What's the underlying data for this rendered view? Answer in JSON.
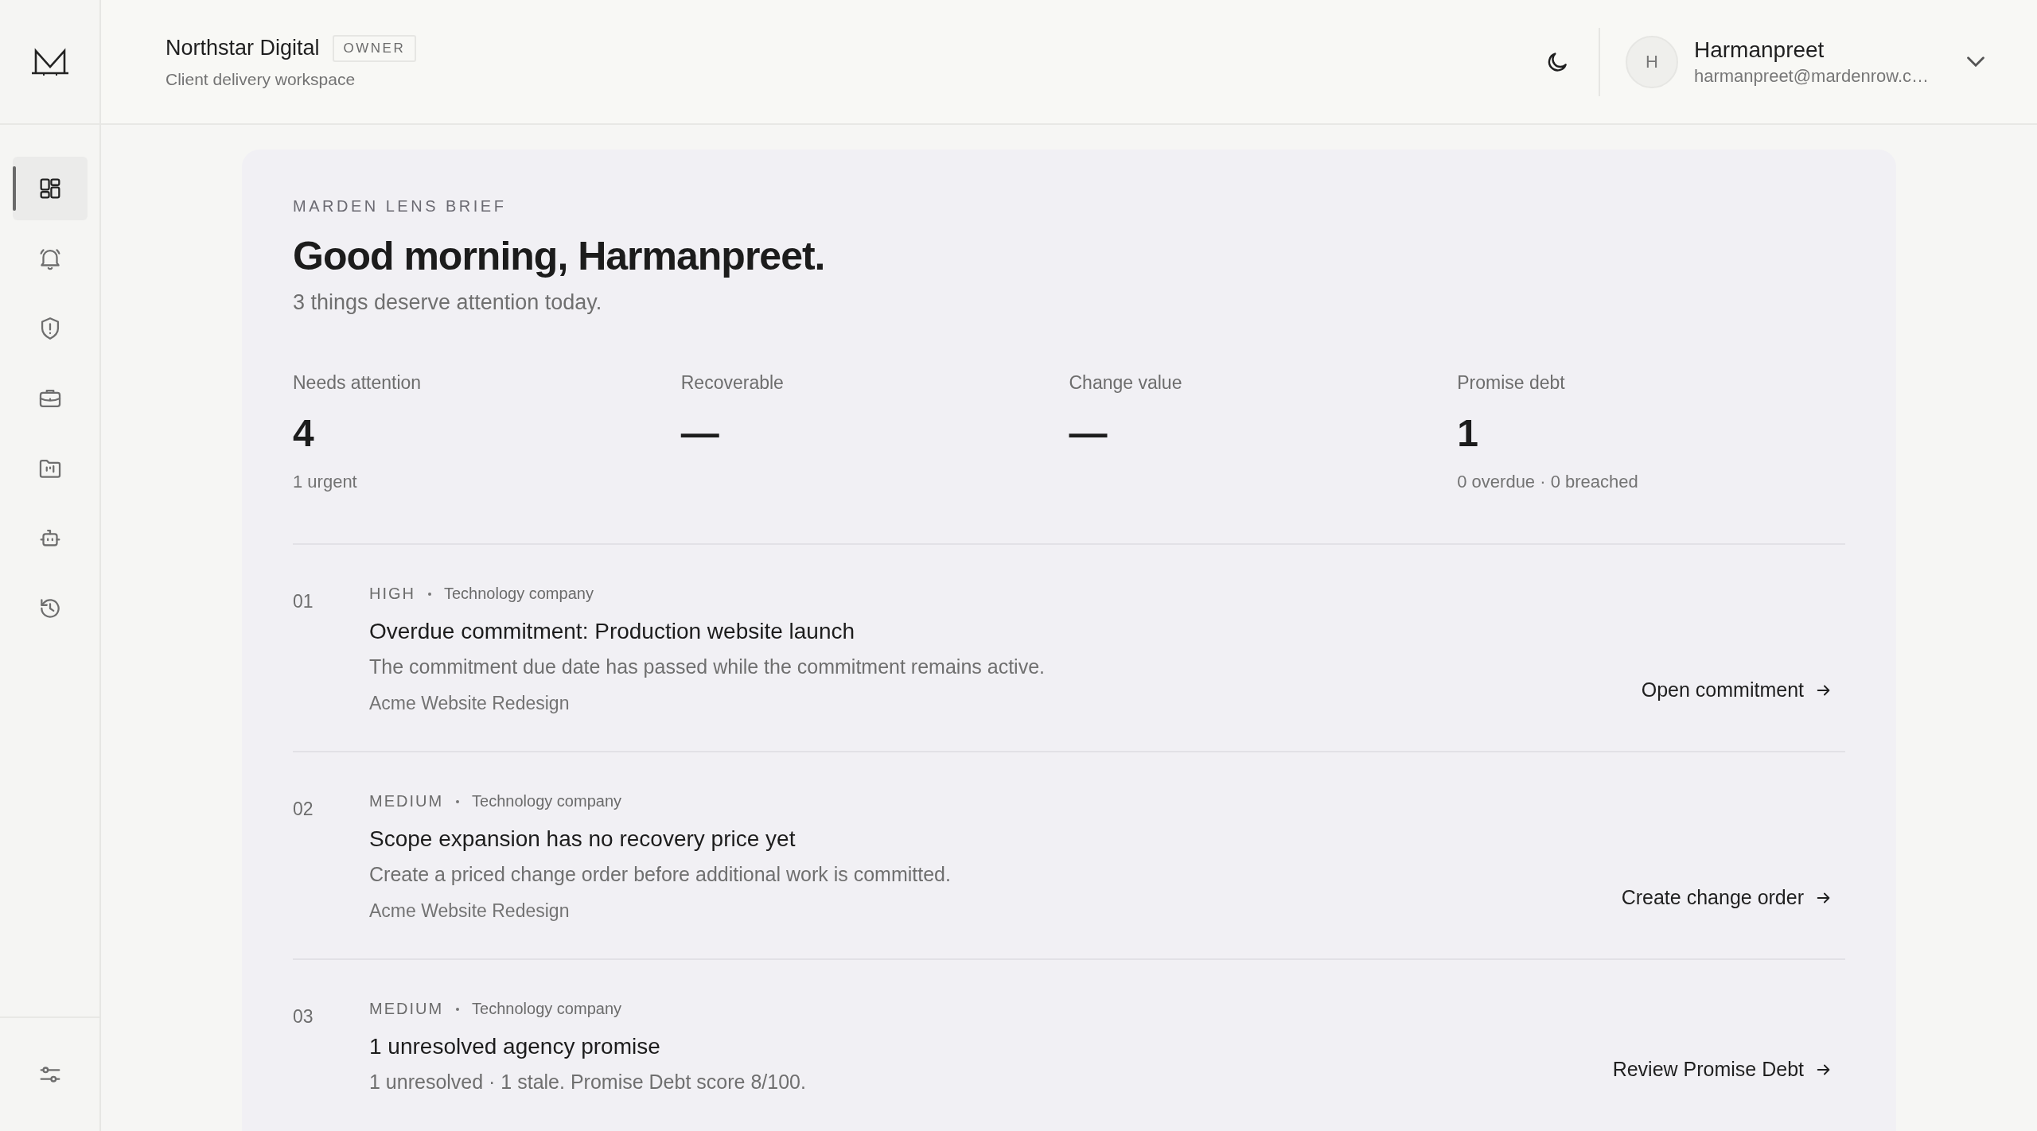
{
  "sidebar": {
    "items": [
      {
        "kind": "dashboard",
        "selected": true
      },
      {
        "kind": "alerts",
        "selected": false
      },
      {
        "kind": "risk",
        "selected": false
      },
      {
        "kind": "work",
        "selected": false
      },
      {
        "kind": "reports",
        "selected": false
      },
      {
        "kind": "assistant",
        "selected": false
      },
      {
        "kind": "history",
        "selected": false
      }
    ],
    "bottom_items": [
      {
        "kind": "settings",
        "selected": false
      }
    ]
  },
  "header": {
    "workspace": {
      "name": "Northstar Digital",
      "role": "OWNER",
      "subtitle": "Client delivery workspace"
    },
    "user": {
      "initial": "H",
      "name": "Harmanpreet",
      "email": "harmanpreet@mardenrow.c…"
    }
  },
  "brief": {
    "eyebrow": "MARDEN LENS BRIEF",
    "greeting": "Good morning, Harmanpreet.",
    "summary": "3 things deserve attention today.",
    "stats": [
      {
        "label": "Needs attention",
        "value": "4",
        "note": "1 urgent"
      },
      {
        "label": "Recoverable",
        "value": "—"
      },
      {
        "label": "Change value",
        "value": "—"
      },
      {
        "label": "Promise debt",
        "value": "1",
        "note": "0 overdue · 0 breached"
      }
    ],
    "items": [
      {
        "number": "01",
        "priority": "HIGH",
        "category": "Technology company",
        "title": "Overdue commitment: Production website launch",
        "description": "The commitment due date has passed while the commitment remains active.",
        "project": "Acme Website Redesign",
        "action": "Open commitment"
      },
      {
        "number": "02",
        "priority": "MEDIUM",
        "category": "Technology company",
        "title": "Scope expansion has no recovery price yet",
        "description": "Create a priced change order before additional work is committed.",
        "project": "Acme Website Redesign",
        "action": "Create change order"
      },
      {
        "number": "03",
        "priority": "MEDIUM",
        "category": "Technology company",
        "title": "1 unresolved agency promise",
        "description": "1 unresolved · 1 stale. Promise Debt score 8/100.",
        "action": "Review Promise Debt"
      }
    ]
  }
}
